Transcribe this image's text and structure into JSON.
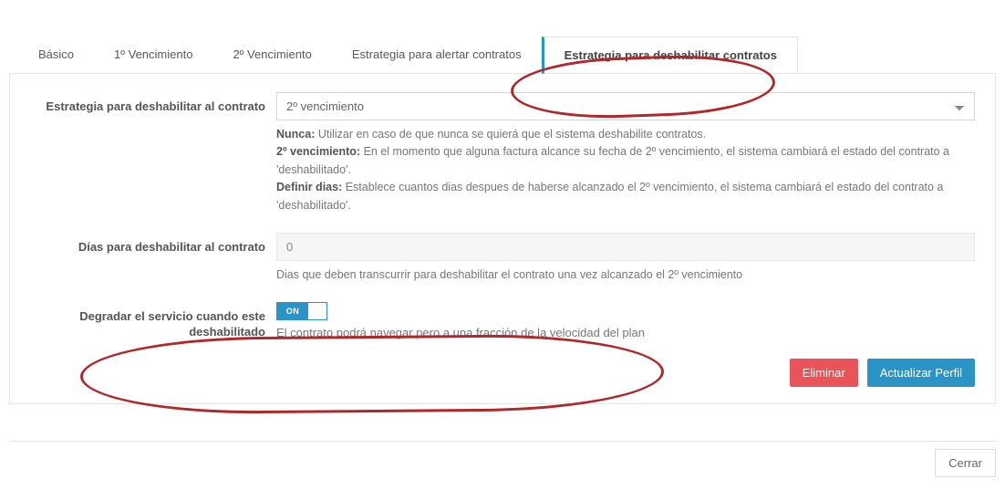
{
  "tabs": {
    "basico": "Básico",
    "venc1": "1º Vencimiento",
    "venc2": "2º Vencimiento",
    "alertar": "Estrategia para alertar contratos",
    "deshabilitar": "Estrategia para deshabilitar contratos"
  },
  "form": {
    "estrategia": {
      "label": "Estrategia para deshabilitar al contrato",
      "selected": "2º vencimiento",
      "help_nunca_b": "Nunca:",
      "help_nunca": " Utilizar en caso de que nunca se quierá que el sistema deshabilite contratos.",
      "help_2v_b": "2º vencimiento:",
      "help_2v": " En el momento que alguna factura alcance su fecha de 2º vencimiento, el sistema cambiará el estado del contrato a 'deshabilitado'.",
      "help_def_b": "Definir dias:",
      "help_def": " Establece cuantos dias despues de haberse alcanzado el 2º vencimiento, el sistema cambiará el estado del contrato a 'deshabilitado'."
    },
    "dias": {
      "label": "Días para deshabilitar al contrato",
      "value": "0",
      "help": "Dias que deben transcurrir para deshabilitar el contrato una vez alcanzado el 2º vencimiento"
    },
    "degradar": {
      "label": "Degradar el servicio cuando este deshabilitado",
      "toggle": "ON",
      "help": "El contrato podrá navegar pero a una fracción de la velocidad del plan"
    }
  },
  "actions": {
    "eliminar": "Eliminar",
    "actualizar": "Actualizar Perfil"
  },
  "footer": {
    "cerrar": "Cerrar"
  }
}
